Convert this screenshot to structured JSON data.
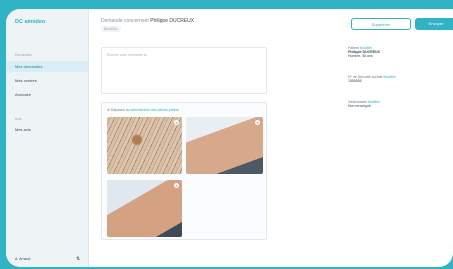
{
  "app": {
    "logo": "DC aimideo"
  },
  "sidebar": {
    "section1": "Demandes",
    "items": [
      {
        "label": "Mes demandes"
      },
      {
        "label": "Mes centres"
      },
      {
        "label": "Annuaire"
      }
    ],
    "section2": "Avis",
    "items2": [
      {
        "label": "Mes avis"
      }
    ],
    "user": "A. Arnaud",
    "lang_icon": "language-icon"
  },
  "header": {
    "title_prefix": "Demande concernant",
    "patient_name": "Philippe DUCREUX",
    "status": "Brouillon",
    "delete_label": "Supprimer",
    "send_label": "Envoyer"
  },
  "message": {
    "placeholder": "Écrivez votre demande ici"
  },
  "attachments": {
    "label_prefix": "Déposez ou",
    "link": "sélectionnez des pièces jointes",
    "photos": 3
  },
  "patient": {
    "label": "Patient",
    "edit": "Modifier",
    "name": "Philippe DUCREUX",
    "details": "Homme, 56 ans",
    "secu_label": "N° de Sécurité sociale",
    "secu_edit": "Modifier",
    "secu_value": "1555555",
    "dest_label": "Destinataire",
    "dest_edit": "Modifier",
    "dest_value": "Non renseigné"
  },
  "colors": {
    "accent": "#2fb3c5",
    "frame": "#2fb3c5"
  }
}
